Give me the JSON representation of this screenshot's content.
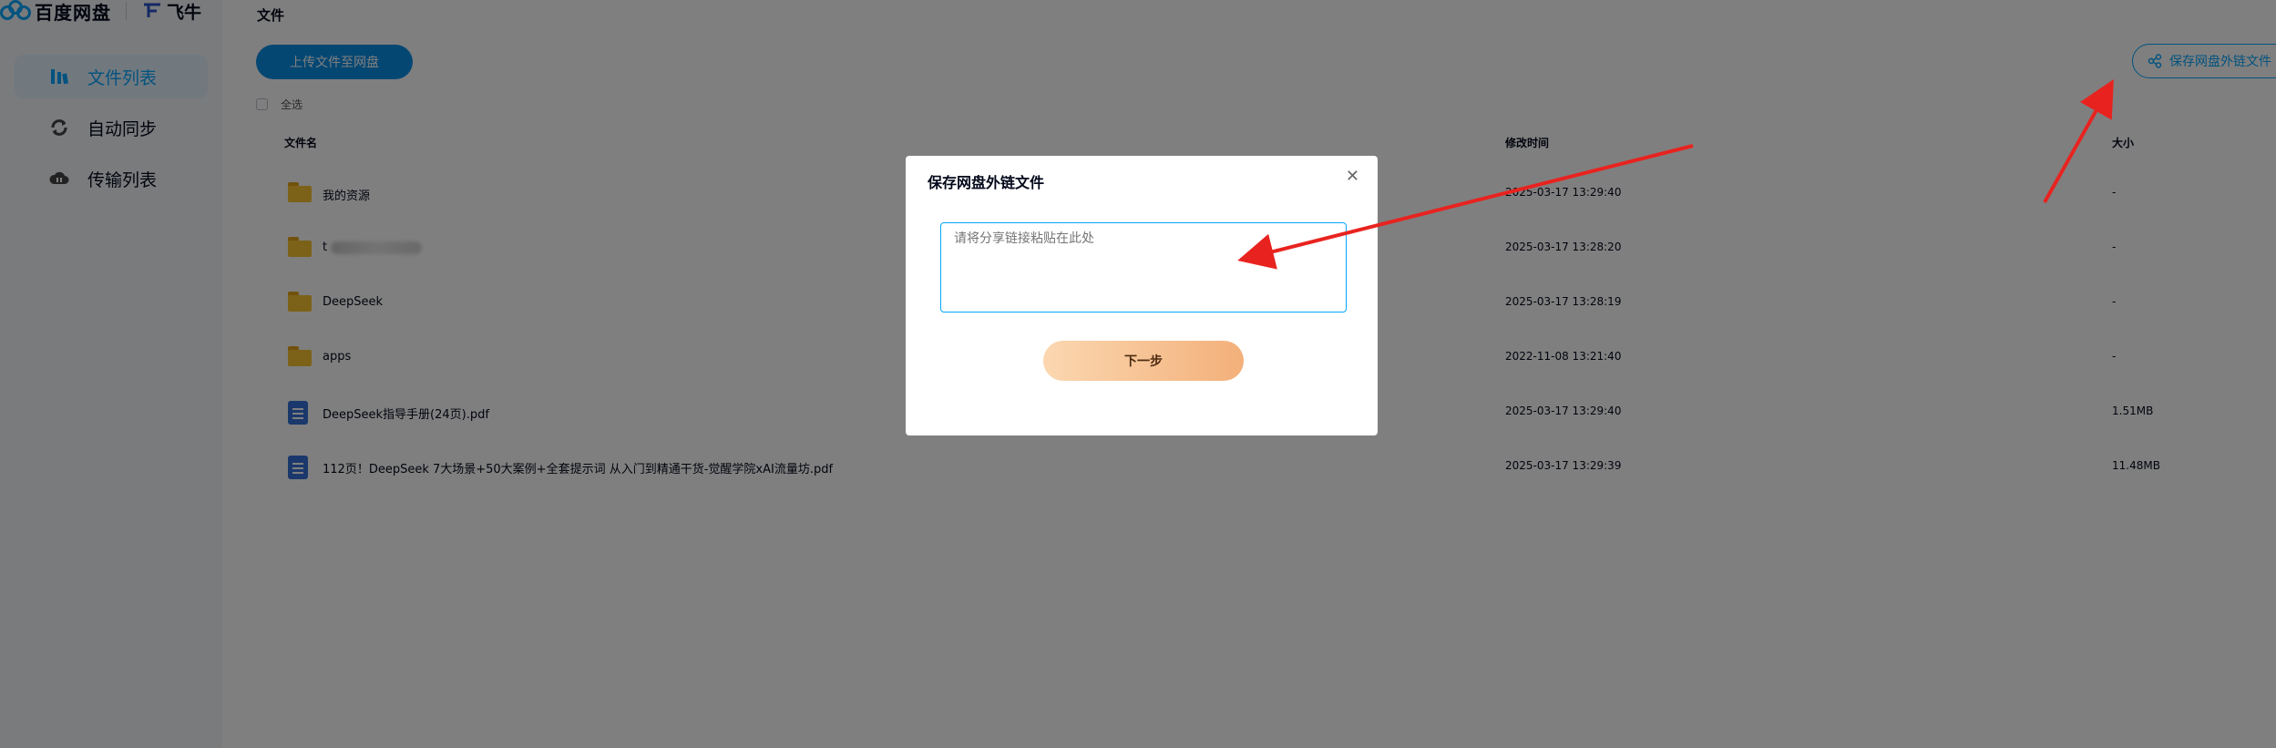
{
  "brand": {
    "name": "百度网盘",
    "partner": "飞牛"
  },
  "sidebar": {
    "items": [
      {
        "label": "文件列表",
        "icon": "file-list-icon",
        "active": true
      },
      {
        "label": "自动同步",
        "icon": "sync-icon",
        "active": false
      },
      {
        "label": "传输列表",
        "icon": "transfer-icon",
        "active": false
      }
    ]
  },
  "main": {
    "title": "文件",
    "upload_label": "上传文件至网盘",
    "save_link_label": "保存网盘外链文件",
    "select_all_label": "全选",
    "columns": {
      "name": "文件名",
      "modified": "修改时间",
      "size": "大小"
    },
    "files": [
      {
        "type": "folder",
        "name": "我的资源",
        "modified": "2025-03-17 13:29:40",
        "size": "-"
      },
      {
        "type": "folder",
        "name": "t",
        "modified": "2025-03-17 13:28:20",
        "size": "-"
      },
      {
        "type": "folder",
        "name": "DeepSeek",
        "modified": "2025-03-17 13:28:19",
        "size": "-"
      },
      {
        "type": "folder",
        "name": "apps",
        "modified": "2022-11-08 13:21:40",
        "size": "-"
      },
      {
        "type": "pdf",
        "name": "DeepSeek指导手册(24页).pdf",
        "modified": "2025-03-17 13:29:40",
        "size": "1.51MB"
      },
      {
        "type": "pdf",
        "name": "112页！DeepSeek 7大场景+50大案例+全套提示词 从入门到精通干货-觉醒学院xAI流量坊.pdf",
        "modified": "2025-03-17 13:29:39",
        "size": "11.48MB"
      }
    ]
  },
  "dialog": {
    "title": "保存网盘外链文件",
    "placeholder": "请将分享链接粘贴在此处",
    "next_label": "下一步"
  },
  "colors": {
    "accent": "#06a7ff",
    "upload_button": "#0a8fe6",
    "arrow": "#e8231f"
  }
}
